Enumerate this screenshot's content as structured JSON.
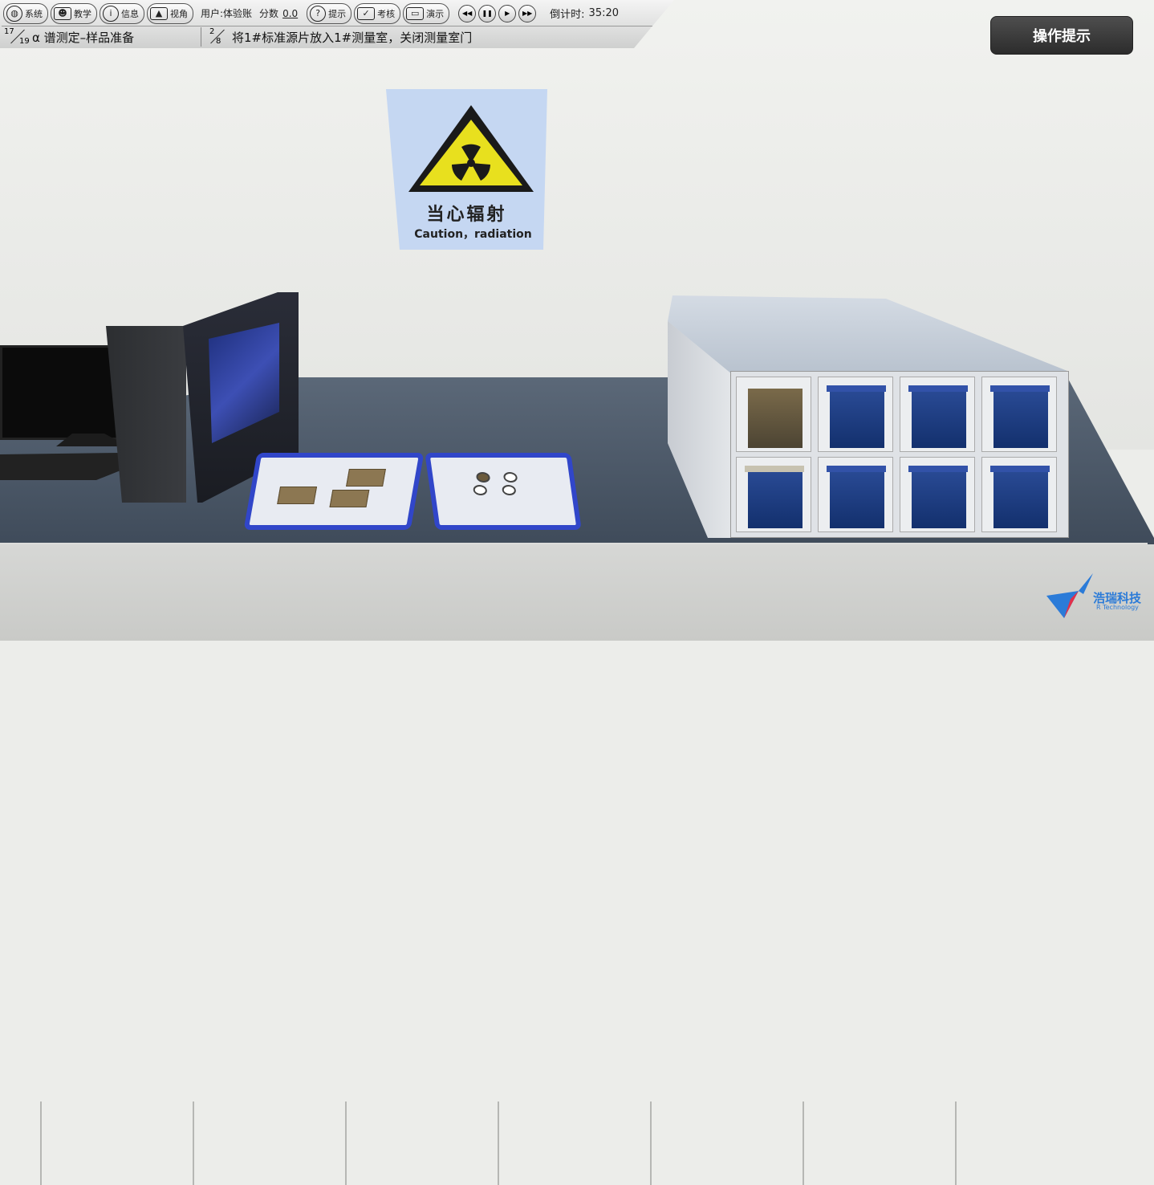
{
  "toolbar": {
    "buttons": [
      {
        "label": "系统",
        "icon": "globe-icon"
      },
      {
        "label": "教学",
        "icon": "teacher-icon"
      },
      {
        "label": "信息",
        "icon": "info-icon"
      },
      {
        "label": "视角",
        "icon": "view-icon"
      }
    ],
    "user_label": "用户:体验账",
    "score_label": "分数",
    "score_value": "0.0",
    "mode_buttons": [
      {
        "label": "提示",
        "icon": "question-icon"
      },
      {
        "label": "考核",
        "icon": "clipboard-icon"
      },
      {
        "label": "演示",
        "icon": "monitor-icon"
      }
    ],
    "playback": [
      "rewind-icon",
      "pause-icon",
      "play-icon",
      "fast-forward-icon"
    ],
    "countdown_label": "倒计时:",
    "countdown_value": "35:20"
  },
  "progress": {
    "task_num": "17",
    "task_total": "19",
    "task_title": "α 谱测定–样品准备",
    "step_num": "2",
    "step_total": "8",
    "step_desc": "将1#标准源片放入1#测量室，关闭测量室门"
  },
  "hint_button": "操作提示",
  "sign": {
    "title_cn": "当心辐射",
    "title_en": "Caution，radiation",
    "colors": {
      "triangle": "#e8e01e",
      "symbol": "#1a1a1a",
      "background": "#c5d7f2"
    }
  },
  "logo": {
    "name_cn": "浩瑞科技",
    "name_en": "R Technology"
  },
  "colors": {
    "tray_rim": "#3146c9",
    "counter": "#4a5666",
    "hint_button_bg": "#3a3a3a"
  }
}
